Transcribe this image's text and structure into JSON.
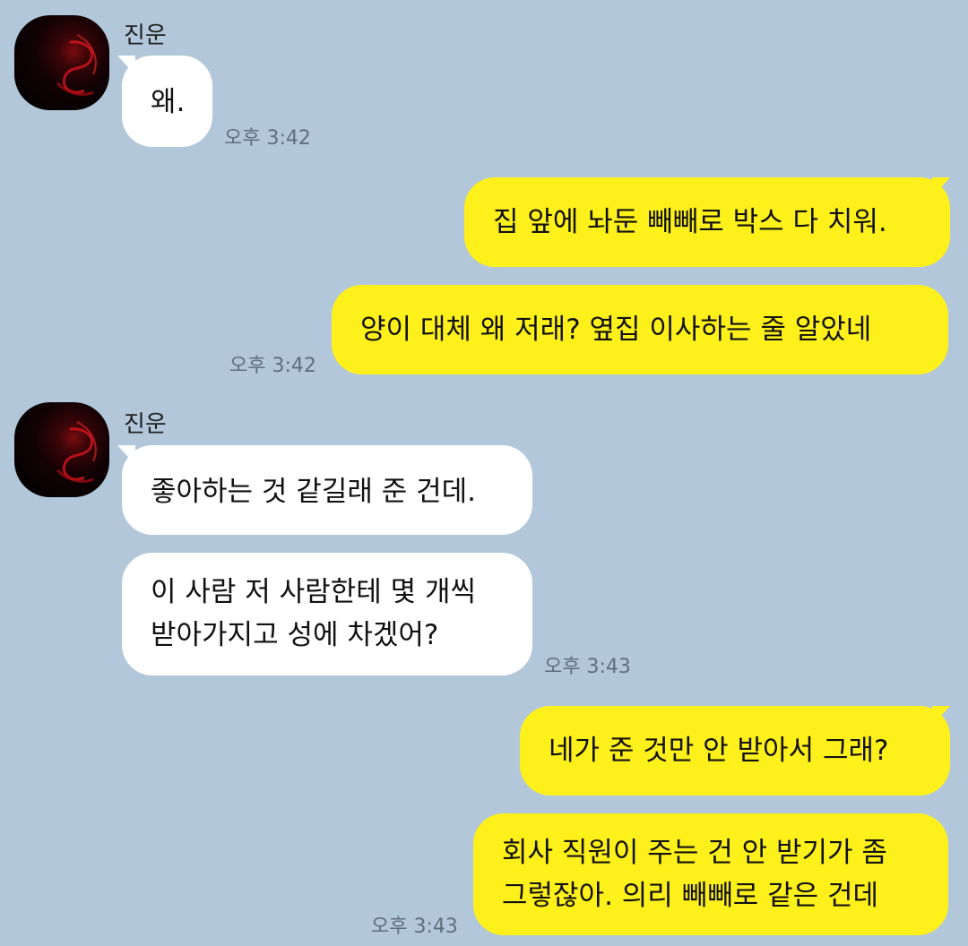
{
  "colors": {
    "background": "#b2c7d9",
    "incoming_bubble": "#ffffff",
    "outgoing_bubble": "#fef01b",
    "timestamp": "#5f6f7e"
  },
  "messages": [
    {
      "sender": "진운",
      "direction": "incoming",
      "avatar_icon": "profile-avatar-icon",
      "bubbles": [
        [
          "왜."
        ]
      ],
      "time": "오후 3:42"
    },
    {
      "direction": "outgoing",
      "bubbles": [
        [
          "집 앞에 놔둔 빼빼로 박스 다 치워."
        ],
        [
          "양이 대체 왜 저래? 옆집 이사하는 줄 알았네"
        ]
      ],
      "time": "오후 3:42"
    },
    {
      "sender": "진운",
      "direction": "incoming",
      "avatar_icon": "profile-avatar-icon",
      "bubbles": [
        [
          "좋아하는 것 같길래 준 건데."
        ],
        [
          "이 사람 저 사람한테 몇 개씩",
          "받아가지고 성에 차겠어?"
        ]
      ],
      "time": "오후 3:43"
    },
    {
      "direction": "outgoing",
      "bubbles": [
        [
          "네가 준 것만 안 받아서 그래?"
        ],
        [
          "회사 직원이 주는 건 안 받기가 좀",
          "그렇잖아. 의리 빼빼로 같은 건데"
        ]
      ],
      "time": "오후 3:43"
    }
  ]
}
